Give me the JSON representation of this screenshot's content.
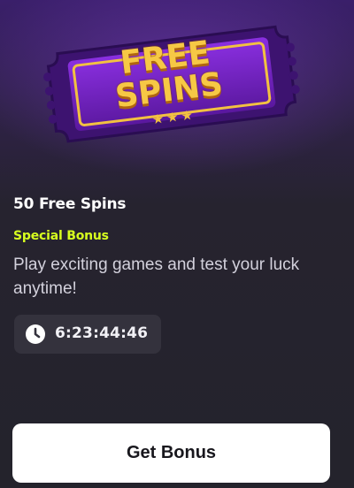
{
  "offer": {
    "badge_line1": "FREE",
    "badge_line2": "SPINS",
    "title": "50 Free Spins",
    "category": "Special Bonus",
    "description": "Play exciting games and test your luck anytime!",
    "countdown": "6:23:44:46",
    "cta_label": "Get Bonus"
  },
  "icons": {
    "timer": "clock-icon",
    "rating": "star-icon"
  },
  "colors": {
    "accent": "#d7ff1f",
    "ticket": "#6b1fb6",
    "gold": "#f6c845",
    "background": "#25232d",
    "button": "#ffffff"
  }
}
